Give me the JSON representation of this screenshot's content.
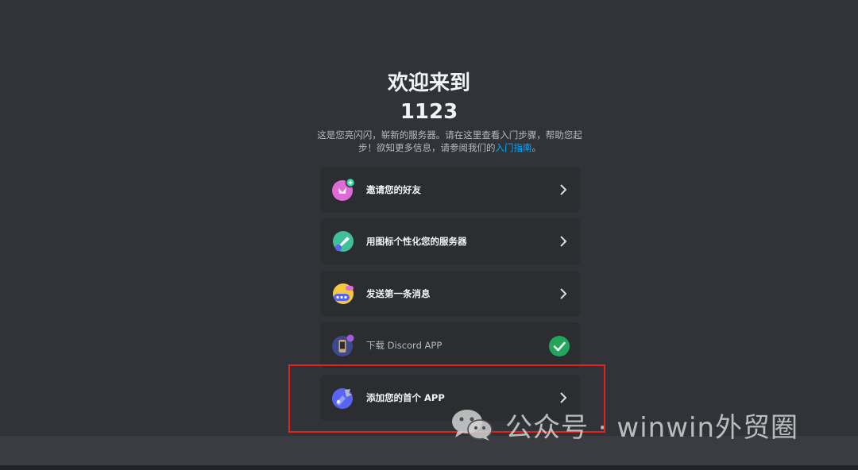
{
  "welcome": {
    "title": "欢迎来到",
    "server_name": "1123",
    "description_prefix": "这是您亮闪闪，崭新的服务器。请在这里查看入门步骤，帮助您起步！欲知更多信息，请参阅我们的",
    "guide_link": "入门指南",
    "description_suffix": "。"
  },
  "steps": [
    {
      "label": "邀请您的好友",
      "icon": "invite-friends-icon",
      "completed": false
    },
    {
      "label": "用图标个性化您的服务器",
      "icon": "brush-icon",
      "completed": false
    },
    {
      "label": "发送第一条消息",
      "icon": "message-icon",
      "completed": false
    },
    {
      "label": "下载 Discord APP",
      "icon": "phone-download-icon",
      "completed": true
    },
    {
      "label": "添加您的首个 APP",
      "icon": "app-wrench-icon",
      "completed": false
    }
  ],
  "watermark": {
    "text": "公众号 · winwin外贸圈"
  },
  "colors": {
    "background": "#313338",
    "card": "#2b2d31",
    "link": "#00a8fc",
    "success": "#23a55a",
    "highlight": "#e2231a"
  }
}
